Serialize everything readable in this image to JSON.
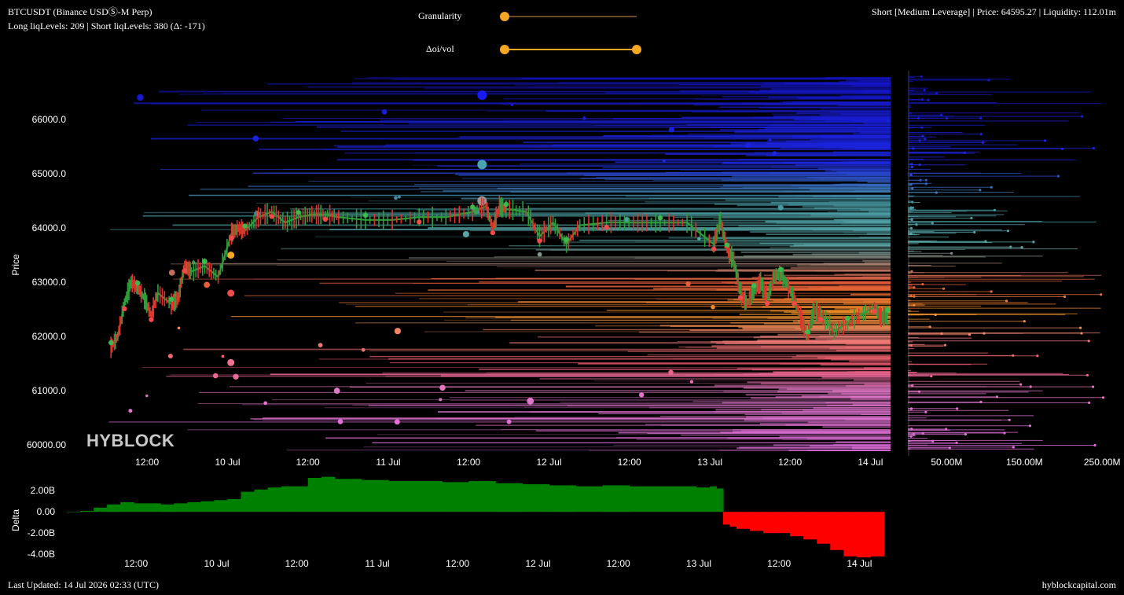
{
  "header": {
    "symbol_line": "BTCUSDT (Binance USDⓈ-M Perp)",
    "levels_line": "Long liqLevels: 209 | Short liqLevels: 380 (Δ: -171)",
    "status_line": "Short [Medium Leverage] | Price: 64595.27 | Liquidity: 112.01m"
  },
  "controls": {
    "granularity": {
      "label": "Granularity",
      "value": 0.0
    },
    "oi_vol": {
      "label": "Δoi/vol",
      "range": [
        0.0,
        1.0
      ]
    }
  },
  "watermark": "HYBLOCK",
  "footer": {
    "last_updated": "Last Updated: 14 Jul 2026 02:33 (UTC)",
    "site": "hyblockcapital.com"
  },
  "colors": {
    "accent": "#f5a623",
    "candle_up": "#2e9e3c",
    "candle_down": "#e0342a",
    "delta_pos": "#008000",
    "delta_neg": "#ff0000"
  },
  "chart_data": [
    {
      "type": "line",
      "ylabel": "Price",
      "ylim": [
        59800,
        66900
      ],
      "yticks": [
        "66000.0",
        "65000.0",
        "64000.0",
        "63000.0",
        "62000.0",
        "61000.0",
        "60000.00"
      ],
      "ytick_values": [
        66000,
        65000,
        64000,
        63000,
        62000,
        61000,
        60000
      ],
      "xticks": [
        "12:00",
        "10 Jul",
        "12:00",
        "11 Jul",
        "12:00",
        "12 Jul",
        "12:00",
        "13 Jul",
        "12:00",
        "14 Jul"
      ],
      "xtick_hours": [
        12,
        24,
        36,
        48,
        60,
        72,
        84,
        96,
        108,
        120
      ],
      "price_series": {
        "x_hours": [
          6.6,
          7.6,
          8.6,
          9.6,
          10.6,
          11.6,
          12.6,
          13.6,
          15.6,
          16.6,
          17.6,
          18.6,
          20.6,
          22.6,
          24.6,
          25.6,
          26.6,
          28.6,
          30.6,
          32.6,
          34.6,
          36.6,
          38.6,
          40.6,
          44.6,
          48.6,
          52.6,
          56.6,
          60.6,
          62.6,
          63.6,
          64.6,
          65.6,
          68.6,
          70.6,
          72.6,
          74.6,
          76.6,
          80.6,
          84.6,
          88.6,
          92.6,
          96.6,
          97.6,
          98.6,
          99.6,
          100.6,
          101.6,
          102.6,
          103.6,
          104.6,
          105.6,
          106.6,
          107.6,
          108.6,
          109.6,
          110.6,
          111.6,
          112.6,
          114.6,
          116.6,
          118.6,
          120.6,
          121.6,
          122.6
        ],
        "y": [
          61800,
          62000,
          62600,
          63000,
          62900,
          62700,
          62400,
          62800,
          62600,
          62700,
          63300,
          63200,
          63300,
          63100,
          63900,
          64000,
          63950,
          64200,
          64300,
          64100,
          64200,
          64250,
          64250,
          64200,
          64150,
          64150,
          64200,
          64200,
          64300,
          64400,
          64000,
          64400,
          64350,
          64300,
          63850,
          64100,
          63700,
          64050,
          64100,
          64100,
          64100,
          64100,
          63700,
          64150,
          63600,
          63400,
          62800,
          62600,
          62850,
          63000,
          62700,
          63100,
          63150,
          62950,
          62700,
          62350,
          62000,
          62500,
          62400,
          62100,
          62250,
          62400,
          62550,
          62350,
          62400
        ]
      },
      "liquidation_side_axis": {
        "xticks": [
          "50.00M",
          "150.00M",
          "250.00M"
        ],
        "xtick_values": [
          50,
          150,
          250
        ]
      }
    },
    {
      "type": "area",
      "ylabel": "Delta",
      "ylim": [
        -4.8,
        3.2
      ],
      "yticks": [
        "2.00B",
        "0.00",
        "-2.00B",
        "-4.00B"
      ],
      "ytick_values": [
        2,
        0,
        -2,
        -4
      ],
      "xticks": [
        "12:00",
        "10 Jul",
        "12:00",
        "11 Jul",
        "12:00",
        "12 Jul",
        "12:00",
        "13 Jul",
        "12:00",
        "14 Jul"
      ],
      "xtick_hours": [
        12,
        24,
        36,
        48,
        60,
        72,
        84,
        96,
        108,
        120
      ],
      "x_hours": [
        0,
        2,
        4,
        6,
        8,
        10,
        12,
        14,
        16,
        18,
        20,
        22,
        24,
        26,
        28,
        30,
        32,
        34,
        36,
        38,
        40,
        44,
        48,
        52,
        56,
        60,
        64,
        68,
        72,
        76,
        80,
        84,
        88,
        92,
        94,
        96,
        97,
        98,
        99,
        100,
        102,
        104,
        106,
        108,
        110,
        112,
        114,
        116,
        118,
        120,
        122
      ],
      "values": [
        0.0,
        0.1,
        0.4,
        0.7,
        0.9,
        0.8,
        0.8,
        0.7,
        0.8,
        0.9,
        1.0,
        1.1,
        1.2,
        1.9,
        2.1,
        2.3,
        2.4,
        2.4,
        3.2,
        3.3,
        3.1,
        3.0,
        2.9,
        2.9,
        2.8,
        2.9,
        2.7,
        2.6,
        2.5,
        2.4,
        2.5,
        2.4,
        2.4,
        2.4,
        2.3,
        2.4,
        2.2,
        -1.2,
        -1.4,
        -1.6,
        -1.8,
        -2.0,
        -2.0,
        -2.3,
        -2.6,
        -3.0,
        -3.6,
        -4.2,
        -4.3,
        -4.2,
        -4.2
      ]
    }
  ]
}
